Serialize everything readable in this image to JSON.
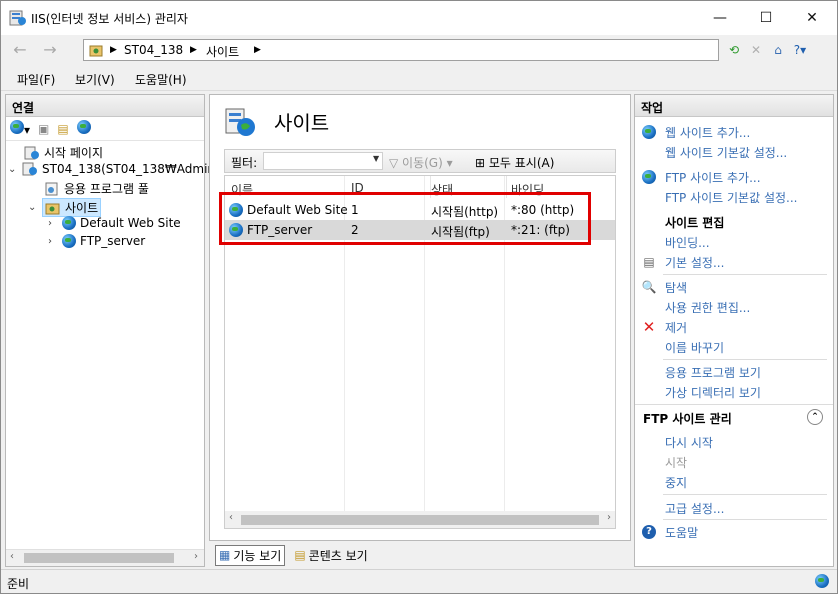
{
  "window": {
    "title": "IIS(인터넷 정보 서비스) 관리자",
    "min": "—",
    "max": "☐",
    "close": "✕"
  },
  "address": {
    "back": "←",
    "forward": "→",
    "crumbs": [
      "ST04_138",
      "사이트"
    ],
    "sep": "▶"
  },
  "menu": {
    "file": "파일(F)",
    "view": "보기(V)",
    "help": "도움말(H)"
  },
  "connections": {
    "header": "연결",
    "tree": [
      {
        "label": "시작 페이지"
      },
      {
        "label": "ST04_138(ST04_138₩Admin"
      },
      {
        "label": "응용 프로그램 풀"
      },
      {
        "label": "사이트"
      },
      {
        "label": "Default Web Site"
      },
      {
        "label": "FTP_server"
      }
    ]
  },
  "center": {
    "title": "사이트",
    "filter": {
      "label": "필터:",
      "go": "이동(G)",
      "show_all": "모두 표시(A)"
    },
    "columns": [
      "이름",
      "ID",
      "상태",
      "바인딩"
    ],
    "rows": [
      {
        "name": "Default Web Site",
        "id": "1",
        "status": "시작됨(http)",
        "binding": "*:80 (http)"
      },
      {
        "name": "FTP_server",
        "id": "2",
        "status": "시작됨(ftp)",
        "binding": "*:21: (ftp)"
      }
    ],
    "tabs": {
      "features": "기능 보기",
      "content": "콘텐츠 보기"
    }
  },
  "actions": {
    "header": "작업",
    "add_site": "웹 사이트 추가...",
    "site_defaults": "웹 사이트 기본값 설정...",
    "add_ftp": "FTP 사이트 추가...",
    "ftp_defaults": "FTP 사이트 기본값 설정...",
    "edit_site": "사이트 편집",
    "bindings": "바인딩...",
    "basic_settings": "기본 설정...",
    "explore": "탐색",
    "edit_perms": "사용 권한 편집...",
    "remove": "제거",
    "rename": "이름 바꾸기",
    "view_apps": "응용 프로그램 보기",
    "view_vdirs": "가상 디렉터리 보기",
    "ftp_manage": "FTP 사이트 관리",
    "restart": "다시 시작",
    "start": "시작",
    "stop": "중지",
    "advanced": "고급 설정...",
    "help": "도움말"
  },
  "status": {
    "text": "준비"
  }
}
